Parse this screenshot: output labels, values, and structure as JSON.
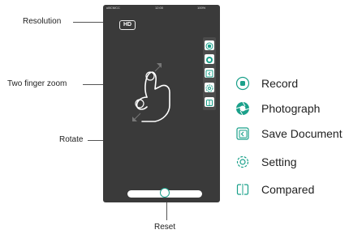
{
  "callouts": {
    "resolution": "Resolution",
    "two_finger_zoom": "Two finger zoom",
    "rotate": "Rotate",
    "reset": "Reset"
  },
  "phone": {
    "status_carrier": "ulllCMCC",
    "status_time": "12:00",
    "status_battery": "100%",
    "resolution_badge": "HD"
  },
  "legend": [
    {
      "icon": "record-icon",
      "label": "Record"
    },
    {
      "icon": "photograph-icon",
      "label": "Photograph"
    },
    {
      "icon": "save-document-icon",
      "label": "Save Document"
    },
    {
      "icon": "setting-icon",
      "label": "Setting"
    },
    {
      "icon": "compared-icon",
      "label": "Compared"
    }
  ],
  "colors": {
    "accent": "#1aa08a",
    "screen": "#3a3a3a",
    "toolbar": "#4b4b4b"
  }
}
